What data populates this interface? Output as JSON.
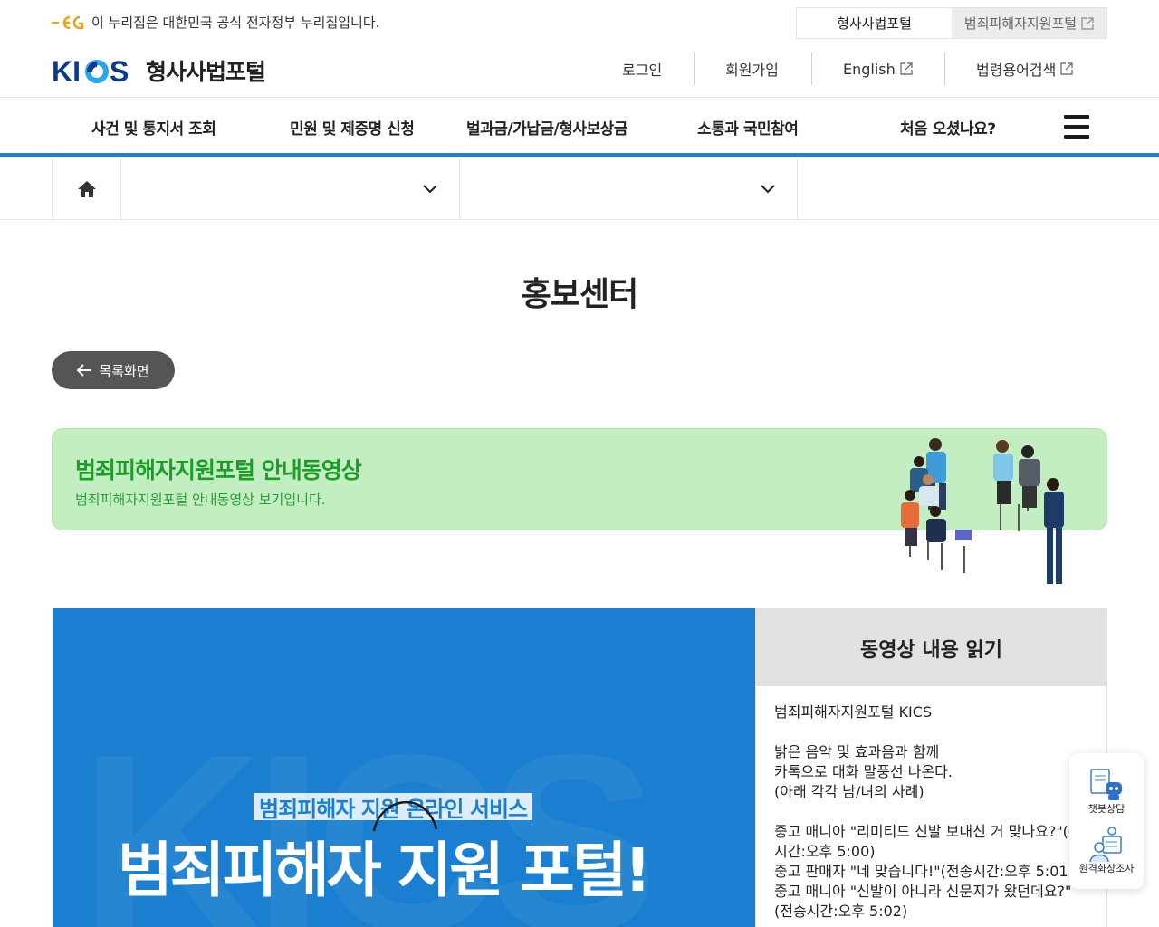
{
  "gov_banner": {
    "notice": "이 누리집은 대한민국 공식 전자정부 누리집입니다.",
    "portal_tabs": [
      {
        "label": "형사사법포털"
      },
      {
        "label": "범죄피해자지원포털"
      }
    ]
  },
  "header": {
    "logo_text": "KICS",
    "site_title": "형사사법포털",
    "util": {
      "login": "로그인",
      "signup": "회원가입",
      "english": "English",
      "glossary": "법령용어검색"
    }
  },
  "gnb": {
    "items": [
      {
        "label": "사건 및 통지서 조회"
      },
      {
        "label": "민원 및 제증명 신청"
      },
      {
        "label": "벌과금/가납금/형사보상금"
      },
      {
        "label": "소통과 국민참여"
      },
      {
        "label": "처음 오셨나요?"
      }
    ]
  },
  "page": {
    "title": "홍보센터",
    "back_label": "목록화면",
    "info_title": "범죄피해자지원포털 안내동영상",
    "info_desc": "범죄피해자지원포털 안내동영상 보기입니다."
  },
  "video": {
    "watermark": "KICS",
    "subtitle": "범죄피해자 지원 온라인 서비스",
    "headline": "범죄피해자 지원 포털!"
  },
  "transcript": {
    "heading": "동영상 내용 읽기",
    "paragraphs": [
      "범죄피해자지원포털 KICS",
      "밝은 음악 및 효과음과 함께\n카톡으로 대화 말풍선 나온다.\n(아래 각각 남/녀의 사례)",
      "중고 매니아 \"리미티드 신발 보내신 거 맞나요?\"(송시간:오후 5:00)\n중고 판매자 \"네 맞습니다!\"(전송시간:오후 5:01)\n중고 매니아 \"신발이 아니라 신문지가 왔던데요?\"(전송시간:오후 5:02)"
    ]
  },
  "floating": {
    "chatbot": "챗봇상담",
    "remote": "원격화상조사"
  },
  "colors": {
    "brand_blue": "#1e7fd8",
    "logo_navy": "#0b3a8c",
    "info_green_bg": "#c2eec1",
    "info_green_text": "#1d9c2a"
  }
}
